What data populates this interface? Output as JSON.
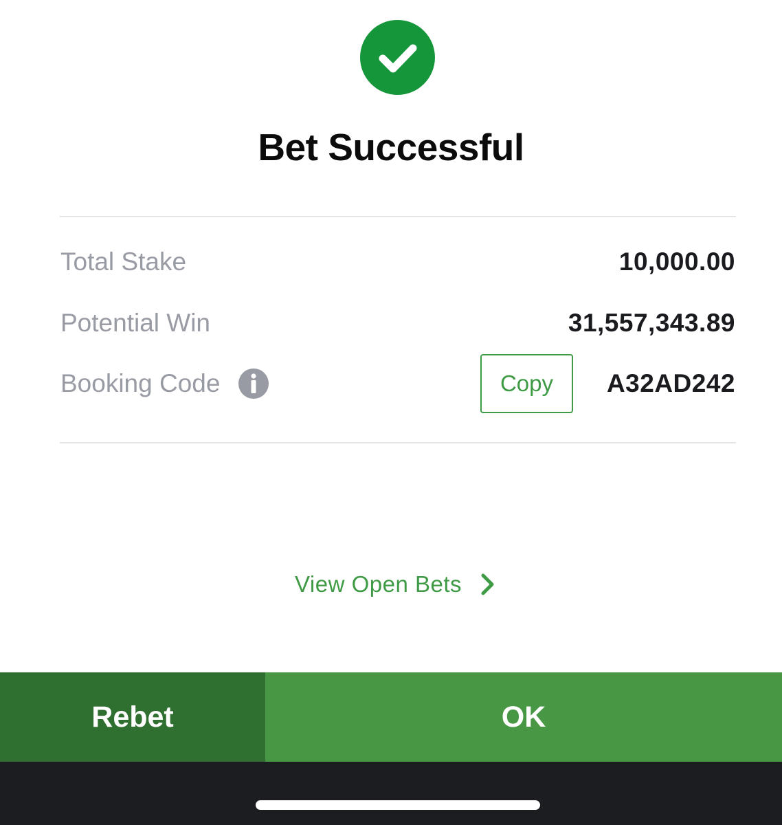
{
  "status": {
    "icon": "checkmark-circle-icon",
    "title": "Bet Successful",
    "color": "#15963a"
  },
  "summary": {
    "total_stake_label": "Total Stake",
    "total_stake_value": "10,000.00",
    "potential_win_label": "Potential Win",
    "potential_win_value": "31,557,343.89",
    "booking_code_label": "Booking Code",
    "booking_code_info_icon": "info-icon",
    "booking_code_value": "A32AD242",
    "copy_label": "Copy"
  },
  "links": {
    "view_open_bets_label": "View Open Bets",
    "view_open_bets_icon": "chevron-right-icon"
  },
  "actions": {
    "rebet_label": "Rebet",
    "ok_label": "OK"
  },
  "colors": {
    "accent": "#3f9a45",
    "rebet_bg": "#2f6f30",
    "ok_bg": "#479745",
    "label_gray": "#999ba4"
  }
}
